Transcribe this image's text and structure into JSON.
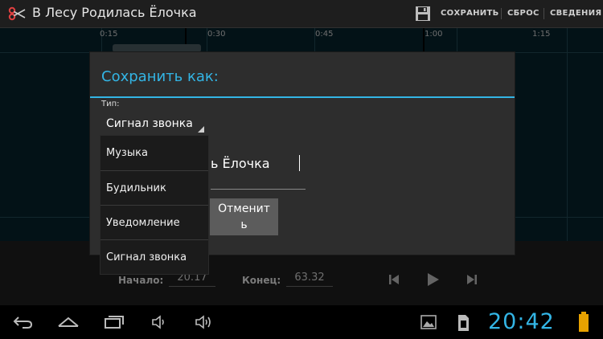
{
  "actionbar": {
    "title": "В Лесу Родилась Ёлочка",
    "icon": "scissors-icon",
    "save_icon": "floppy-disk-icon",
    "save_label": "СОХРАНИТЬ",
    "reset_label": "СБРОС",
    "info_label": "СВЕДЕНИЯ"
  },
  "waveform": {
    "time_ticks": [
      "0:15",
      "0:30",
      "0:45",
      "1:00",
      "1:15"
    ]
  },
  "controls": {
    "start_label": "Начало:",
    "start_value": "20.17",
    "end_label": "Конец:",
    "end_value": "63.32",
    "prev_icon": "skip-previous-icon",
    "play_icon": "play-icon",
    "next_icon": "skip-next-icon"
  },
  "dialog": {
    "title": "Сохранить как:",
    "type_label": "Тип:",
    "type_value": "Сигнал звонка",
    "name_value": "ь Ёлочка",
    "cancel_label": "Отменить"
  },
  "dropdown": {
    "items": [
      "Музыка",
      "Будильник",
      "Уведомление",
      "Сигнал звонка"
    ]
  },
  "navbar": {
    "back_icon": "back-icon",
    "home_icon": "home-icon",
    "recents_icon": "recent-apps-icon",
    "vol_down_icon": "volume-down-icon",
    "vol_up_icon": "volume-up-icon",
    "gallery_icon": "gallery-notification-icon",
    "sd_icon": "sd-card-icon",
    "battery_icon": "battery-icon",
    "clock": "20:42"
  },
  "colors": {
    "accent": "#33b5e5",
    "background": "#000000",
    "dialog": "#2d2d2d"
  }
}
